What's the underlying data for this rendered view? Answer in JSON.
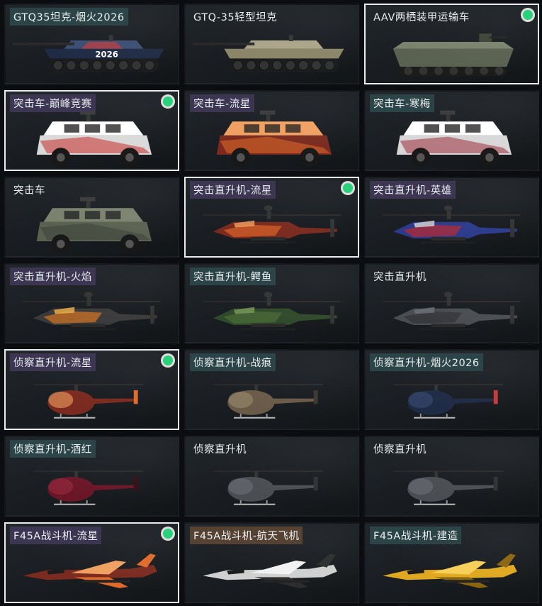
{
  "items": [
    {
      "name": "GTQ35坦克-烟火2026",
      "tag": "teal",
      "selected": false,
      "equipped": false,
      "kind": "tank",
      "livery": "night",
      "decal": "2026"
    },
    {
      "name": "GTQ-35轻型坦克",
      "tag": "none",
      "selected": false,
      "equipped": false,
      "kind": "tank",
      "livery": "khaki",
      "decal": ""
    },
    {
      "name": "AAV两栖装甲运输车",
      "tag": "none",
      "selected": true,
      "equipped": true,
      "kind": "aav",
      "livery": "olive",
      "decal": ""
    },
    {
      "name": "突击车-巅峰竞赛",
      "tag": "purple",
      "selected": true,
      "equipped": true,
      "kind": "car",
      "livery": "race",
      "decal": ""
    },
    {
      "name": "突击车-流星",
      "tag": "purple",
      "selected": false,
      "equipped": false,
      "kind": "car",
      "livery": "meteor",
      "decal": ""
    },
    {
      "name": "突击车-寒梅",
      "tag": "teal",
      "selected": false,
      "equipped": false,
      "kind": "car",
      "livery": "plum",
      "decal": ""
    },
    {
      "name": "突击车",
      "tag": "none",
      "selected": false,
      "equipped": false,
      "kind": "car",
      "livery": "olive",
      "decal": ""
    },
    {
      "name": "突击直升机-流星",
      "tag": "purple",
      "selected": true,
      "equipped": true,
      "kind": "apache",
      "livery": "meteor",
      "decal": ""
    },
    {
      "name": "突击直升机-英雄",
      "tag": "purple",
      "selected": false,
      "equipped": false,
      "kind": "apache",
      "livery": "hero",
      "decal": ""
    },
    {
      "name": "突击直升机-火焰",
      "tag": "purple",
      "selected": false,
      "equipped": false,
      "kind": "apache",
      "livery": "flame",
      "decal": ""
    },
    {
      "name": "突击直升机-鳄鱼",
      "tag": "teal",
      "selected": false,
      "equipped": false,
      "kind": "apache",
      "livery": "croc",
      "decal": ""
    },
    {
      "name": "突击直升机",
      "tag": "none",
      "selected": false,
      "equipped": false,
      "kind": "apache",
      "livery": "grey",
      "decal": ""
    },
    {
      "name": "侦察直升机-流星",
      "tag": "purple",
      "selected": true,
      "equipped": true,
      "kind": "scout",
      "livery": "meteor",
      "decal": ""
    },
    {
      "name": "侦察直升机-战痕",
      "tag": "teal",
      "selected": false,
      "equipped": false,
      "kind": "scout",
      "livery": "scar",
      "decal": ""
    },
    {
      "name": "侦察直升机-烟火2026",
      "tag": "teal",
      "selected": false,
      "equipped": false,
      "kind": "scout",
      "livery": "night",
      "decal": ""
    },
    {
      "name": "侦察直升机-酒红",
      "tag": "teal",
      "selected": false,
      "equipped": false,
      "kind": "scout",
      "livery": "wine",
      "decal": ""
    },
    {
      "name": "侦察直升机",
      "tag": "none",
      "selected": false,
      "equipped": false,
      "kind": "scout",
      "livery": "grey",
      "decal": ""
    },
    {
      "name": "侦察直升机",
      "tag": "none",
      "selected": false,
      "equipped": false,
      "kind": "scout",
      "livery": "grey",
      "decal": ""
    },
    {
      "name": "F45A战斗机-流星",
      "tag": "purple",
      "selected": true,
      "equipped": true,
      "kind": "jet",
      "livery": "meteor",
      "decal": ""
    },
    {
      "name": "F45A战斗机-航天飞机",
      "tag": "brown",
      "selected": false,
      "equipped": false,
      "kind": "jet",
      "livery": "shuttle",
      "decal": ""
    },
    {
      "name": "F45A战斗机-建造",
      "tag": "teal",
      "selected": false,
      "equipped": false,
      "kind": "jet",
      "livery": "yellow",
      "decal": ""
    }
  ],
  "colors": {
    "equipped_dot": "#29d17a",
    "selected_border": "#e8ecef"
  }
}
